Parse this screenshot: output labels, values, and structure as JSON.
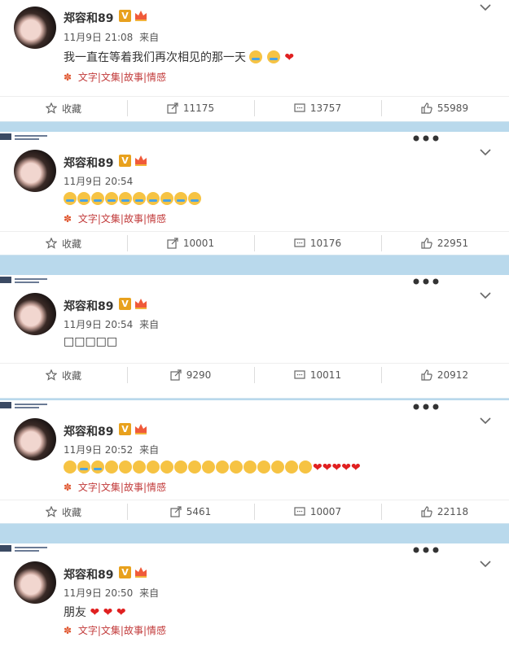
{
  "user": {
    "name": "郑容和89",
    "v_badge": "V"
  },
  "tags_text": "文字|文集|故事|情感",
  "actions_labels": {
    "collect": "收藏"
  },
  "posts": [
    {
      "time": "11月9日 21:08",
      "source": "来自",
      "content": "我一直在等着我们再次相见的那一天",
      "emoji_tail": "cry,cry,heart",
      "stats": {
        "repost": "11175",
        "comment": "13757",
        "like": "55989"
      }
    },
    {
      "time": "11月9日 20:54",
      "source": "",
      "content": "",
      "emoji_tail": "cry×8",
      "stats": {
        "repost": "10001",
        "comment": "10176",
        "like": "22951"
      }
    },
    {
      "time": "11月9日 20:54",
      "source": "来自",
      "content": "□□□□□",
      "emoji_tail": "",
      "stats": {
        "repost": "9290",
        "comment": "10011",
        "like": "20912"
      }
    },
    {
      "time": "11月9日 20:52",
      "source": "来自",
      "content": "",
      "emoji_tail": "mixed",
      "stats": {
        "repost": "5461",
        "comment": "10007",
        "like": "22118"
      }
    },
    {
      "time": "11月9日 20:50",
      "source": "来自",
      "content": "朋友",
      "emoji_tail": "heart,heart,heart",
      "stats": {
        "repost": "",
        "comment": "",
        "like": ""
      }
    }
  ]
}
